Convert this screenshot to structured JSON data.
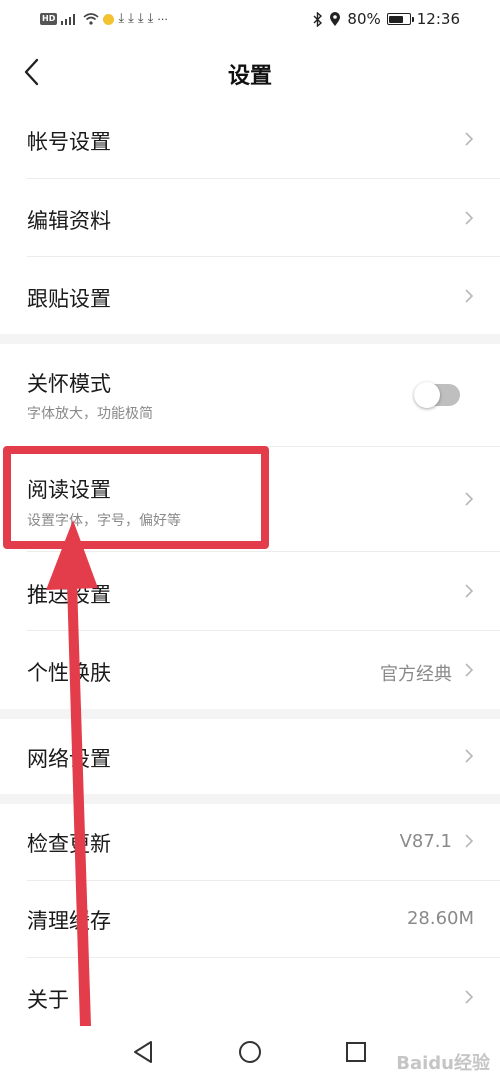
{
  "statusbar": {
    "left_icons": [
      "hd-icon",
      "4g-signal-icon",
      "wifi-icon",
      "app-icon",
      "download-icon",
      "download-icon",
      "download-icon",
      "download-icon",
      "more-icon"
    ],
    "hd_label": "HD",
    "more": "···",
    "battery_percent": "80%",
    "battery_level": 0.8,
    "time": "12:36"
  },
  "header": {
    "title": "设置"
  },
  "settings": {
    "account": {
      "label": "帐号设置"
    },
    "edit_profile": {
      "label": "编辑资料"
    },
    "paste": {
      "label": "跟贴设置"
    },
    "care_mode": {
      "label": "关怀模式",
      "subtitle": "字体放大，功能极简",
      "enabled": false
    },
    "reading": {
      "label": "阅读设置",
      "subtitle": "设置字体，字号，偏好等"
    },
    "push": {
      "label": "推送设置"
    },
    "skin": {
      "label": "个性换肤",
      "value": "官方经典"
    },
    "network": {
      "label": "网络设置"
    },
    "update": {
      "label": "检查更新",
      "value": "V87.1"
    },
    "cache": {
      "label": "清理缓存",
      "value": "28.60M"
    },
    "about": {
      "label": "关于"
    }
  },
  "colors": {
    "annotation": "#e33d4b",
    "section_gap": "#f4f4f4",
    "toggle_off": "#bfbfbf"
  },
  "watermark": "Baidu经验"
}
